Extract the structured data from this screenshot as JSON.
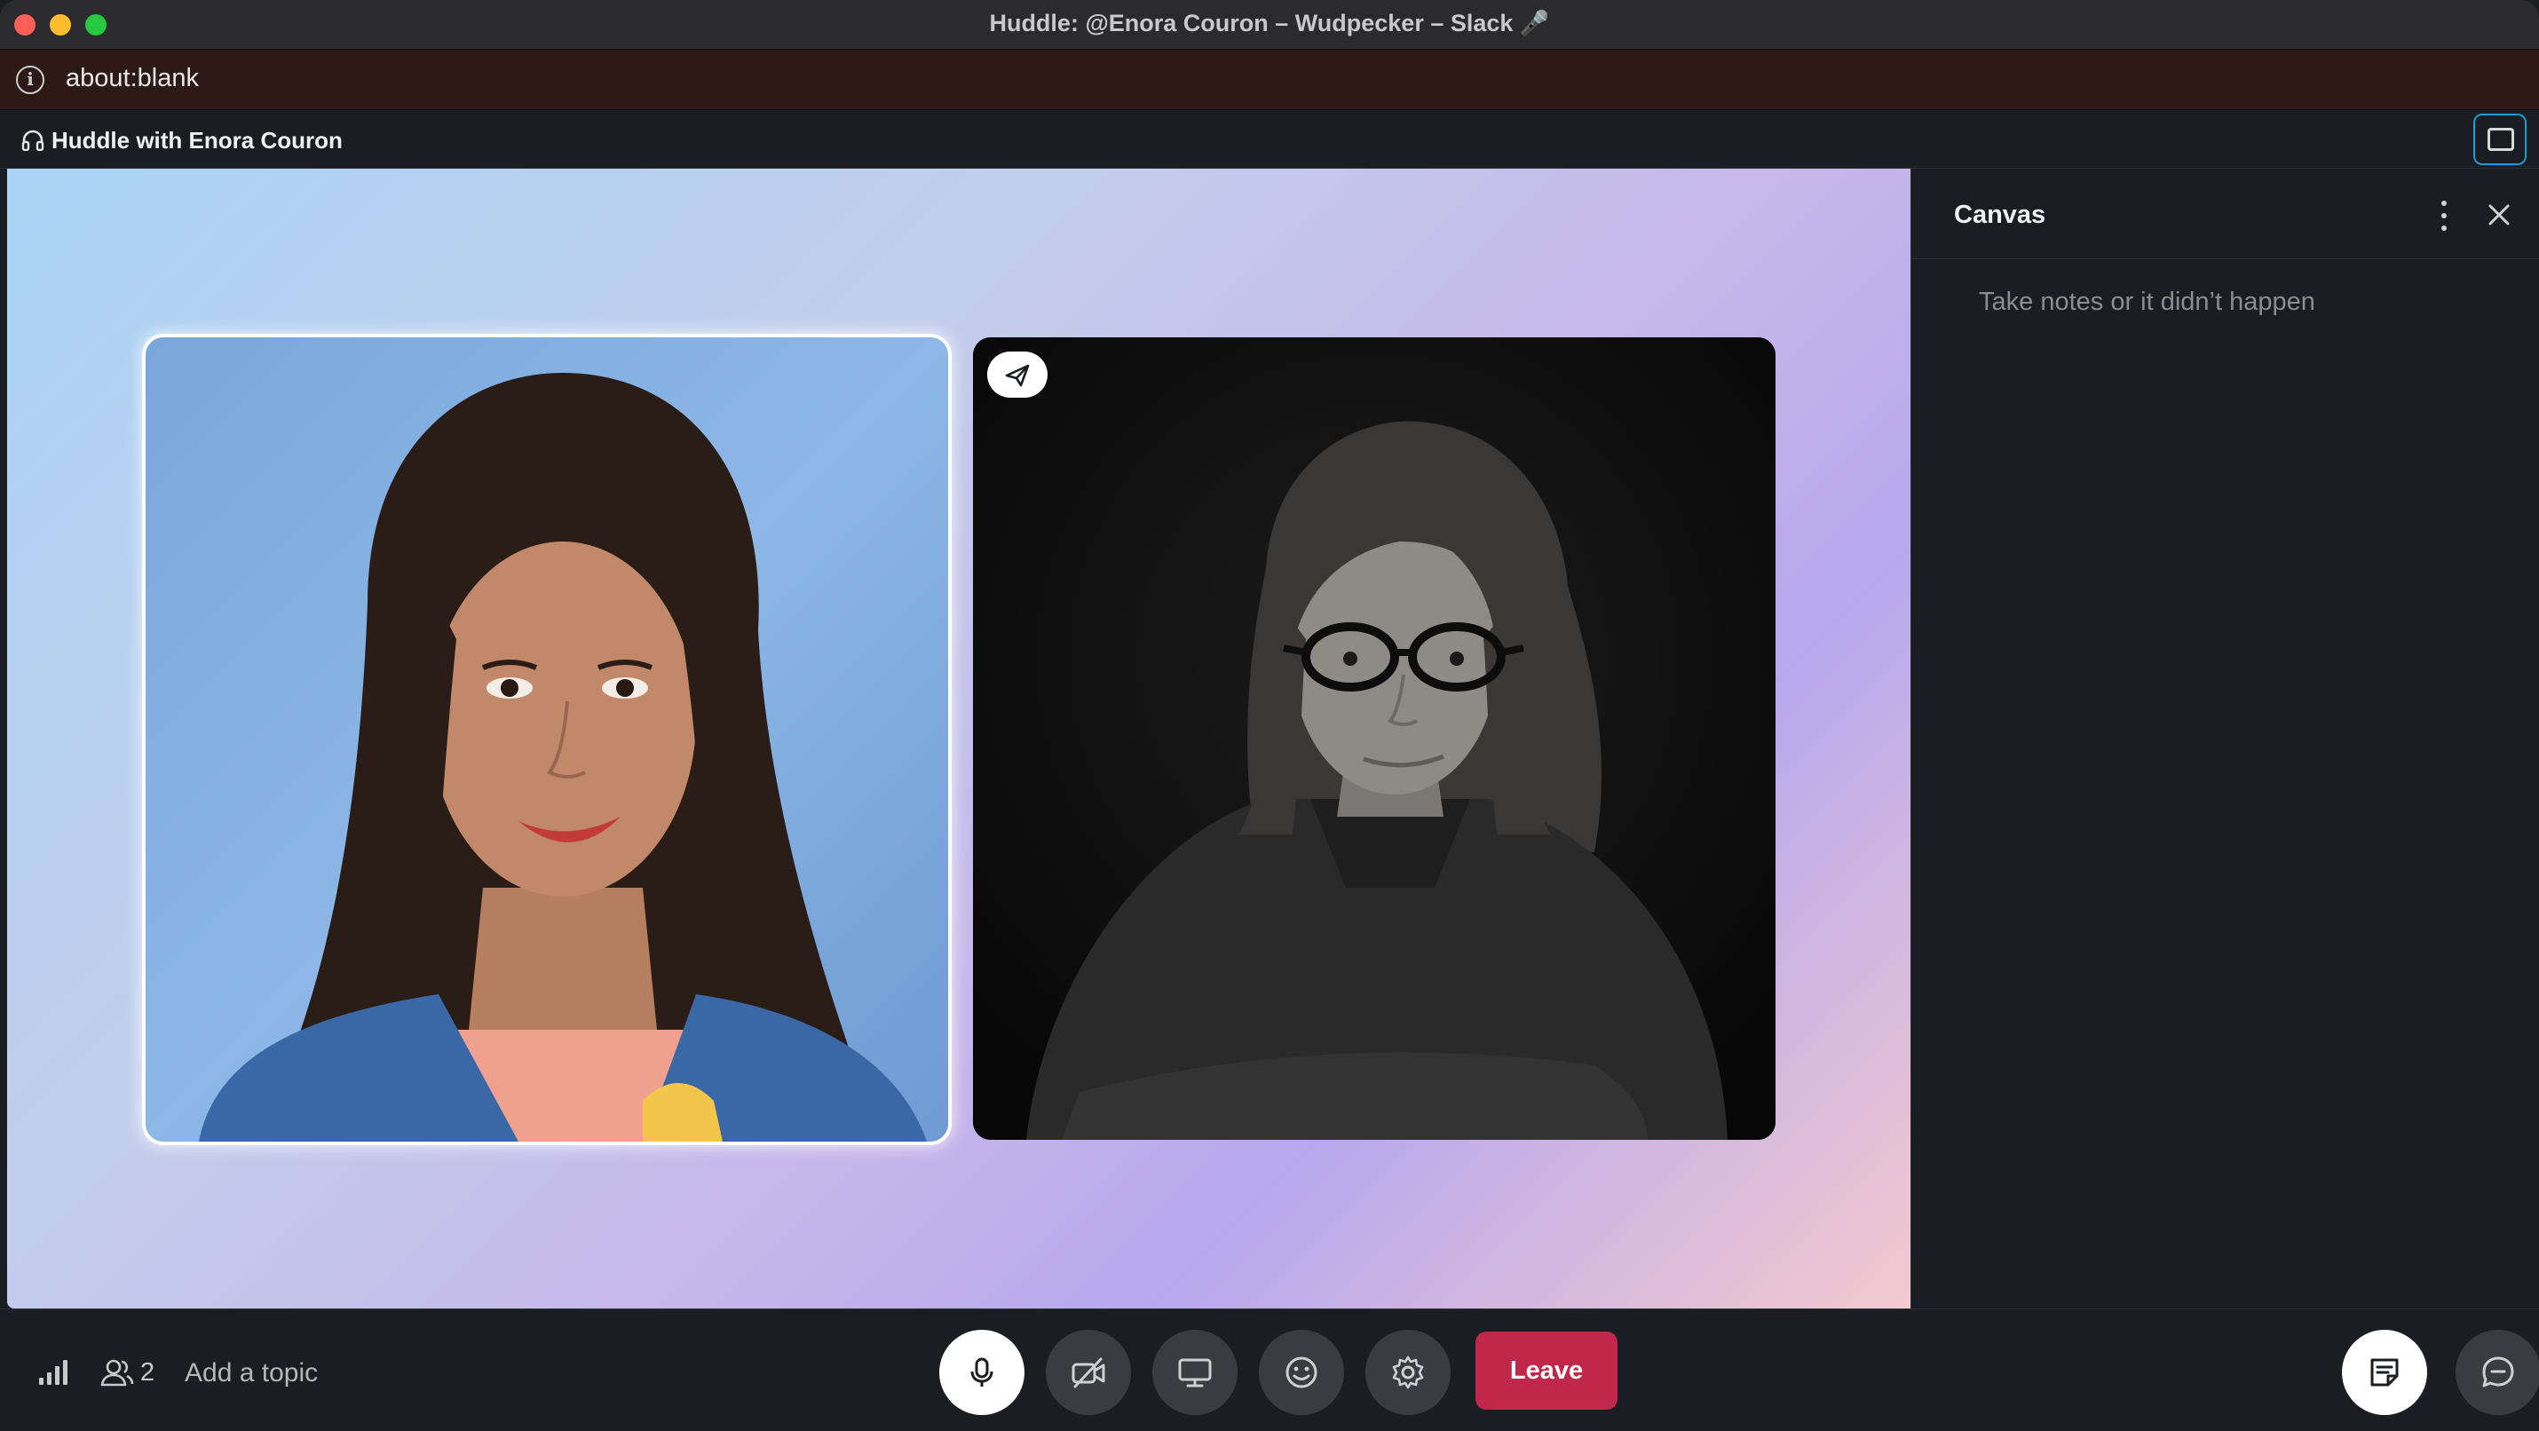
{
  "window": {
    "title": "Huddle: @Enora Couron – Wudpecker – Slack 🎤"
  },
  "urlbar": {
    "url": "about:blank"
  },
  "huddle": {
    "title": "Huddle with Enora Couron",
    "participant_count": "2",
    "topic_placeholder": "Add a topic"
  },
  "canvas": {
    "title": "Canvas",
    "placeholder": "Take notes or it didn’t happen"
  },
  "controls": {
    "leave_label": "Leave",
    "icons": [
      "microphone-icon",
      "video-off-icon",
      "screen-share-icon",
      "emoji-icon",
      "settings-icon",
      "canvas-icon",
      "thread-icon"
    ]
  },
  "colors": {
    "leave": "#c1274a",
    "accent": "#1d9bd1",
    "background": "#1a1d21"
  }
}
